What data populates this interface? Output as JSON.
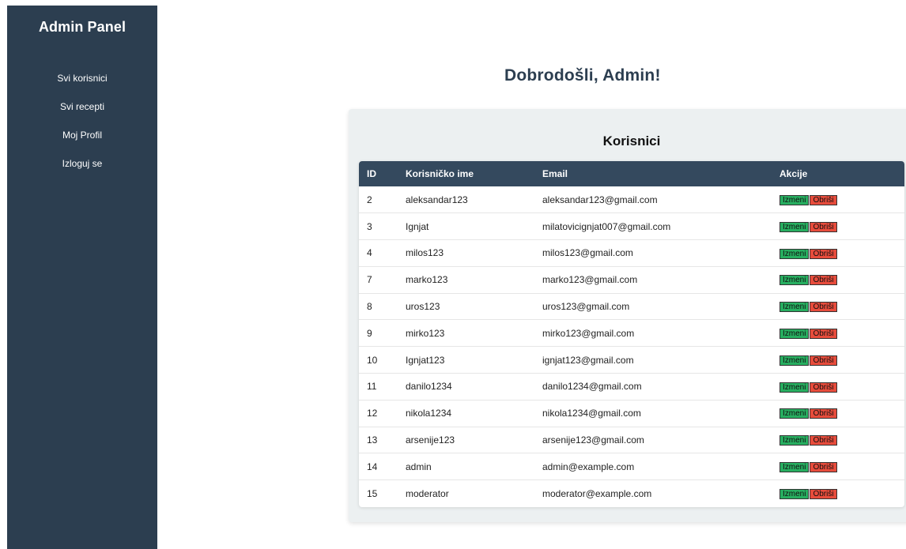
{
  "sidebar": {
    "title": "Admin Panel",
    "items": [
      "Svi korisnici",
      "Svi recepti",
      "Moj Profil",
      "Izloguj se"
    ]
  },
  "main": {
    "welcome": "Dobrodošli, Admin!",
    "card_title": "Korisnici",
    "columns": [
      "ID",
      "Korisničko ime",
      "Email",
      "Akcije"
    ],
    "edit_label": "Izmeni",
    "delete_label": "Obriši",
    "rows": [
      {
        "id": "2",
        "username": "aleksandar123",
        "email": "aleksandar123@gmail.com"
      },
      {
        "id": "3",
        "username": "Ignjat",
        "email": "milatovicignjat007@gmail.com"
      },
      {
        "id": "4",
        "username": "milos123",
        "email": "milos123@gmail.com"
      },
      {
        "id": "7",
        "username": "marko123",
        "email": "marko123@gmail.com"
      },
      {
        "id": "8",
        "username": "uros123",
        "email": "uros123@gmail.com"
      },
      {
        "id": "9",
        "username": "mirko123",
        "email": "mirko123@gmail.com"
      },
      {
        "id": "10",
        "username": "Ignjat123",
        "email": "ignjat123@gmail.com"
      },
      {
        "id": "11",
        "username": "danilo1234",
        "email": "danilo1234@gmail.com"
      },
      {
        "id": "12",
        "username": "nikola1234",
        "email": "nikola1234@gmail.com"
      },
      {
        "id": "13",
        "username": "arsenije123",
        "email": "arsenije123@gmail.com"
      },
      {
        "id": "14",
        "username": "admin",
        "email": "admin@example.com"
      },
      {
        "id": "15",
        "username": "moderator",
        "email": "moderator@example.com"
      }
    ]
  },
  "colors": {
    "sidebar_bg": "#2c3e50",
    "table_header_bg": "#34495e",
    "edit_button": "#27ae60",
    "delete_button": "#e74c3c",
    "panel_bg": "#ecf0f1"
  }
}
